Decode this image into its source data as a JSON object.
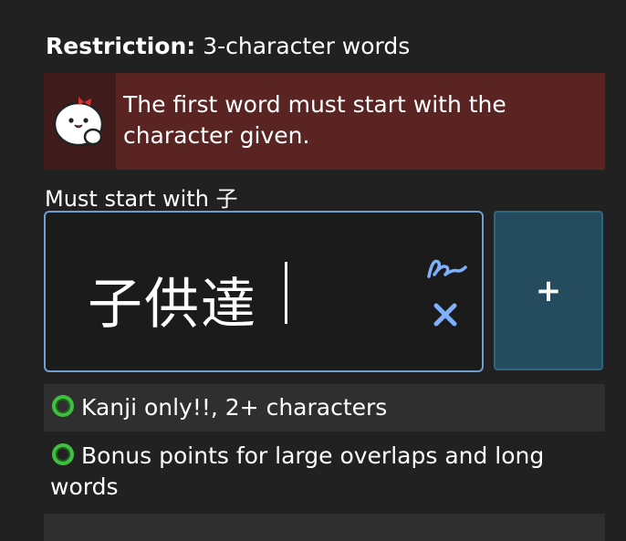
{
  "restriction": {
    "label": "Restriction:",
    "value": "3-character words"
  },
  "notice": {
    "message": "The first word must start with the character given."
  },
  "hint": {
    "text": "Must start with 子"
  },
  "input": {
    "value": "子供達"
  },
  "add_button": {
    "label": "+"
  },
  "rules": [
    {
      "text": "Kanji only!!, 2+ characters",
      "status": "ok"
    },
    {
      "text": "Bonus points for large overlaps and long words",
      "status": "ok"
    }
  ],
  "colors": {
    "background": "#212121",
    "notice_bg": "#5a2423",
    "input_border": "#6f9ecf",
    "add_button_bg": "#244b5e",
    "ok_green": "#3fbf3f",
    "icon_blue": "#7fb0ff"
  },
  "icons": {
    "mascot": "mascot-icon",
    "handwrite": "handwrite-icon",
    "clear": "clear-icon",
    "ok": "check-circle-icon"
  }
}
